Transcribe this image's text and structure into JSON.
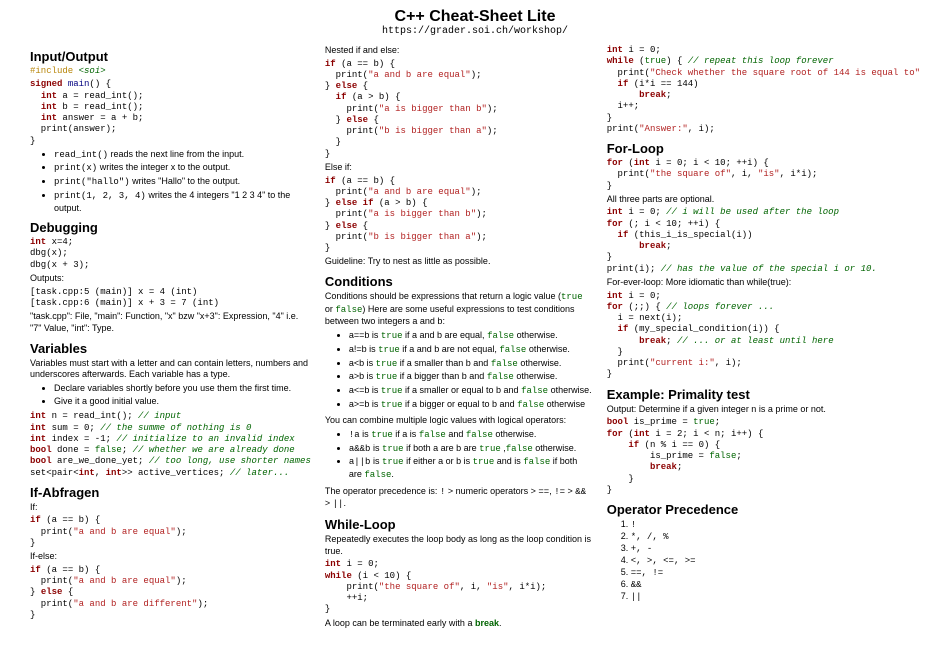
{
  "header": {
    "title": "C++ Cheat-Sheet Lite",
    "url": "https://grader.soi.ch/workshop/"
  },
  "col1": {
    "io_title": "Input/Output",
    "io_bul1": " reads the next line from the input.",
    "io_bul2": " writes the integer x to the output.",
    "io_bul3": " writes \"Hallo\" to the output.",
    "io_bul4": " writes the 4 integers \"1 2 3 4\" to the output.",
    "dbg_title": "Debugging",
    "dbg_out": "Outputs:",
    "dbg_line1": "[task.cpp:5 (main)] x = 4 (int)",
    "dbg_line2": "[task.cpp:6 (main)] x + 3 = 7 (int)",
    "dbg_expl": "\"task.cpp\": File, \"main\": Function, \"x\" bzw \"x+3\": Expression, \"4\" i.e. \"7\" Value, \"int\": Type.",
    "var_title": "Variables",
    "var_intro": "Variables must start with a letter and can contain letters, numbers and underscores afterwards. Each variable has a type.",
    "var_bul1": "Declare variables shortly before you use them the first time.",
    "var_bul2": "Give it a good initial value.",
    "if_title": "If-Abfragen",
    "if_lbl": "If:",
    "ifelse_lbl": "If-else:"
  },
  "col2": {
    "nested_lbl": "Nested if and else:",
    "elseif_lbl": "Else if:",
    "guideline": "Guideline: Try to nest as little as possible.",
    "cond_title": "Conditions",
    "cond_intro1": "Conditions should be expressions that return a logic value (",
    "cond_intro2": " or ",
    "cond_intro3": ") Here are some useful expressions to test conditions between two integers a and b:",
    "cond_combine": "You can combine multiple logic values with logical operators:",
    "cond_prec": "The operator precedence is: ",
    "while_title": "While-Loop",
    "while_intro": "Repeatedly executes the loop body as long as the loop condition is true.",
    "while_end": "A loop can be terminated early with a "
  },
  "col3": {
    "for_title": "For-Loop",
    "for_opt": "All three parts are optional.",
    "for_ever": "For-ever-loop: More idiomatic than while(true):",
    "prim_title": "Example: Primality test",
    "prim_intro": "Output: Determine if a given integer n is a prime or not.",
    "op_title": "Operator Precedence",
    "op1": "!",
    "op2": "*, /, %",
    "op3": "+, -",
    "op4": "<, >, <=, >=",
    "op5": "==, !=",
    "op6": "&&",
    "op7": "||"
  }
}
